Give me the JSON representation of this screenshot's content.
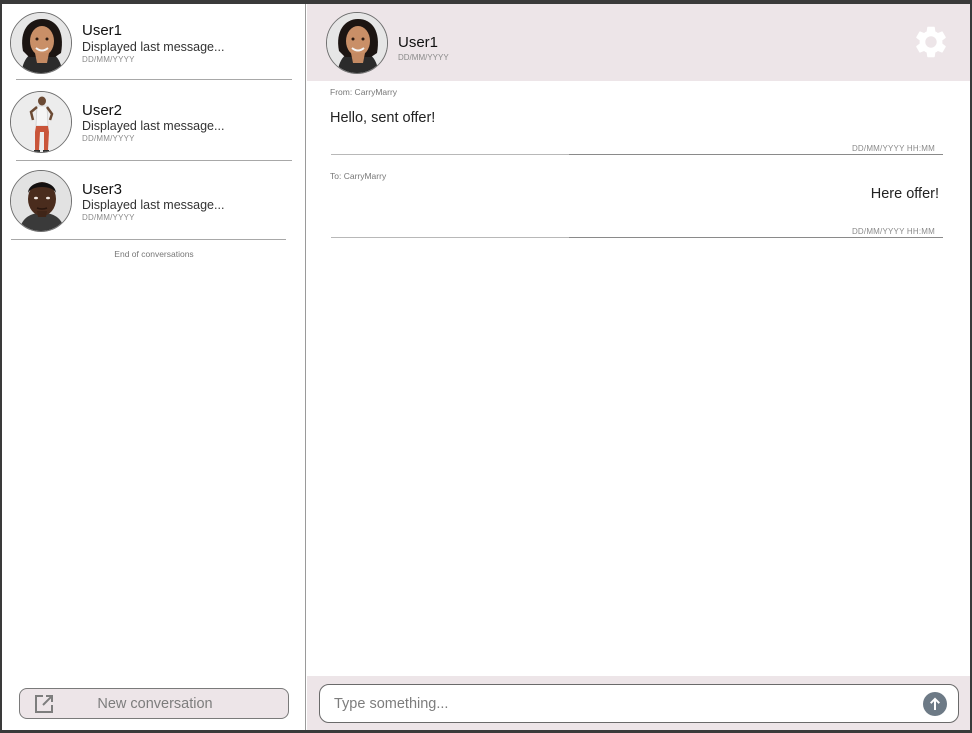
{
  "conversations": [
    {
      "name": "User1",
      "last_message": "Displayed last message...",
      "date": "DD/MM/YYYY",
      "avatar": "woman-portrait"
    },
    {
      "name": "User2",
      "last_message": "Displayed last message...",
      "date": "DD/MM/YYYY",
      "avatar": "man-standing-figure"
    },
    {
      "name": "User3",
      "last_message": "Displayed last message...",
      "date": "DD/MM/YYYY",
      "avatar": "man-portrait"
    }
  ],
  "sidebar": {
    "end_note": "End of conversations",
    "new_conversation_label": "New conversation",
    "new_conversation_icon": "open-external-icon"
  },
  "chat": {
    "header": {
      "name": "User1",
      "date": "DD/MM/YYYY",
      "settings_icon": "gear-icon"
    },
    "messages": [
      {
        "meta": "From: CarryMarry",
        "text": "Hello, sent offer!",
        "time": "DD/MM/YYYY HH:MM",
        "align": "left"
      },
      {
        "meta": "To: CarryMarry",
        "text": "Here offer!",
        "time": "DD/MM/YYYY HH:MM",
        "align": "right"
      }
    ],
    "composer": {
      "placeholder": "Type something...",
      "value": "",
      "send_icon": "arrow-up-circle-icon"
    }
  },
  "colors": {
    "accent_bg": "#ede5e8",
    "send_button": "#6d7a86",
    "gear": "#ffffff"
  }
}
